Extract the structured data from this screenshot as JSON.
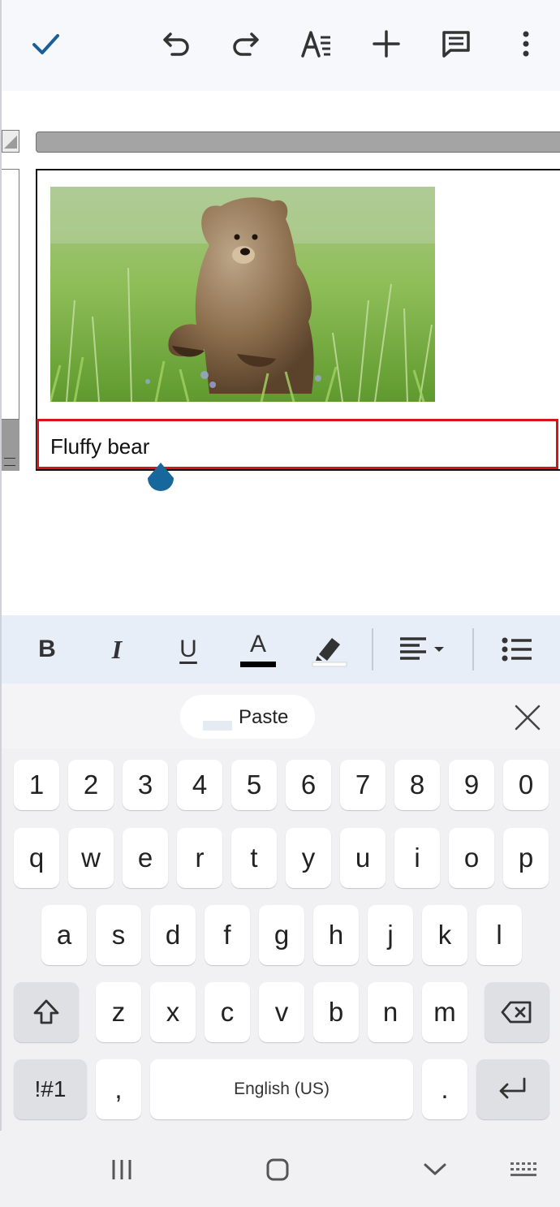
{
  "toolbar": {
    "icons": [
      "check-icon",
      "undo-icon",
      "redo-icon",
      "text-format-icon",
      "plus-icon",
      "comment-icon",
      "more-vert-icon"
    ],
    "accent": "#1a5f99"
  },
  "document": {
    "caption": "Fluffy bear",
    "caption_border_color": "#d8131b",
    "cursor_color": "#16679b"
  },
  "format_bar": {
    "bold": "B",
    "italic": "I",
    "underline": "U",
    "text_color": "A",
    "text_color_value": "#000000"
  },
  "keyboard": {
    "paste_label": "Paste",
    "number_row": [
      "1",
      "2",
      "3",
      "4",
      "5",
      "6",
      "7",
      "8",
      "9",
      "0"
    ],
    "row1": [
      "q",
      "w",
      "e",
      "r",
      "t",
      "y",
      "u",
      "i",
      "o",
      "p"
    ],
    "row2": [
      "a",
      "s",
      "d",
      "f",
      "g",
      "h",
      "j",
      "k",
      "l"
    ],
    "row3": [
      "z",
      "x",
      "c",
      "v",
      "b",
      "n",
      "m"
    ],
    "symbols_key": "!#1",
    "comma_key": ",",
    "space_label": "English (US)",
    "period_key": "."
  },
  "navbar": {
    "icons": [
      "recent-apps-icon",
      "home-icon",
      "back-icon",
      "keyboard-hide-icon"
    ]
  }
}
